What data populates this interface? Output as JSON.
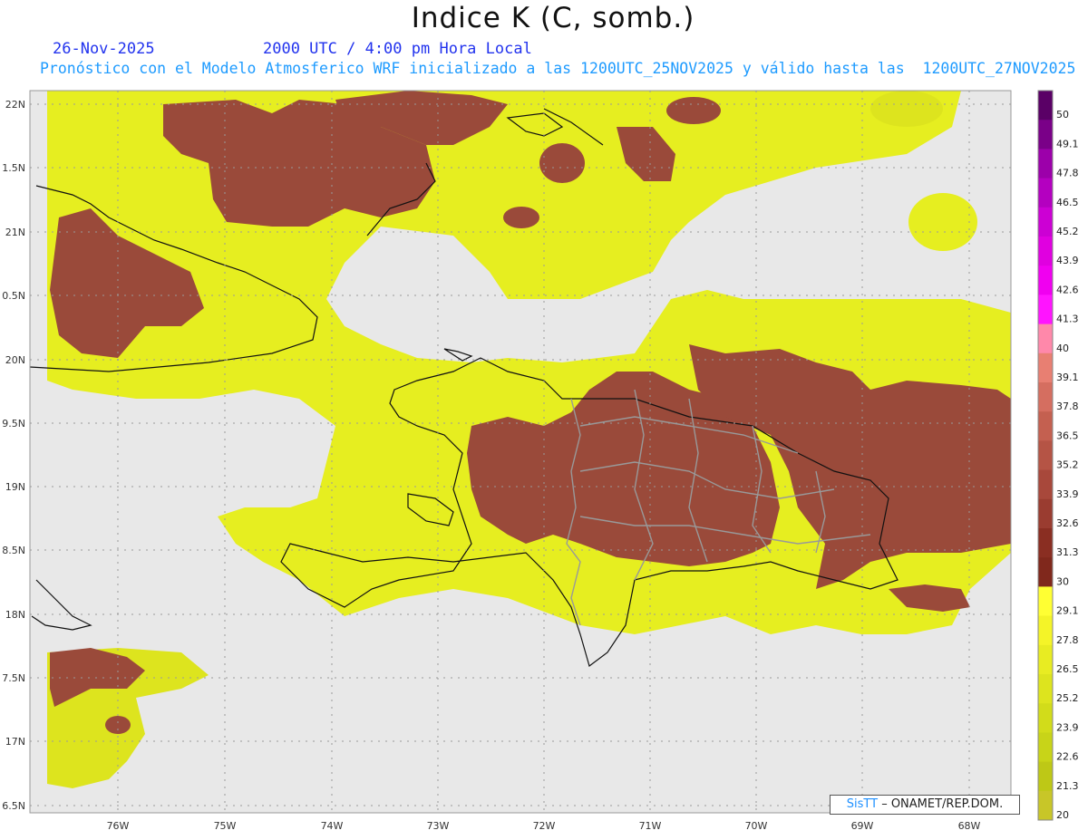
{
  "title": "Indice K (C, somb.)",
  "date": "26-Nov-2025",
  "time": "2000 UTC / 4:00 pm Hora Local",
  "model_line": "Pronóstico con el Modelo Atmosferico WRF inicializado a las 1200UTC_25NOV2025 y válido hasta las  1200UTC_27NOV2025",
  "credit": {
    "brand": "SisTT",
    "text": " – ONAMET/REP.DOM."
  },
  "lat_labels": [
    "22N",
    "1.5N",
    "21N",
    "0.5N",
    "20N",
    "9.5N",
    "19N",
    "8.5N",
    "18N",
    "7.5N",
    "17N",
    "6.5N"
  ],
  "lon_labels": [
    "76W",
    "75W",
    "74W",
    "73W",
    "72W",
    "71W",
    "70W",
    "69W",
    "68W"
  ],
  "colorbar": {
    "labels": [
      "50",
      "49.1",
      "47.8",
      "46.5",
      "45.2",
      "43.9",
      "42.6",
      "41.3",
      "40",
      "39.1",
      "37.8",
      "36.5",
      "35.2",
      "33.9",
      "32.6",
      "31.3",
      "30",
      "29.1",
      "27.8",
      "26.5",
      "25.2",
      "23.9",
      "22.6",
      "21.3",
      "20"
    ],
    "colors": [
      "#5a0066",
      "#7a0088",
      "#9c00aa",
      "#b400c0",
      "#cc00d4",
      "#e000e0",
      "#f000f0",
      "#ff14ff",
      "#ff88aa",
      "#e87f72",
      "#d56e60",
      "#c46050",
      "#b55445",
      "#a8483b",
      "#9a3c30",
      "#8a2e22",
      "#80281c",
      "#ffff33",
      "#f4f428",
      "#e8ec22",
      "#dde41e",
      "#d2dc1a",
      "#c8d418",
      "#bec816",
      "#c8c628"
    ]
  },
  "legend_colors": {
    "missing": "#e8e8e8",
    "high": "#9a4a3a",
    "yellow": "#e6ee20",
    "light_yellow": "#f4f438"
  }
}
